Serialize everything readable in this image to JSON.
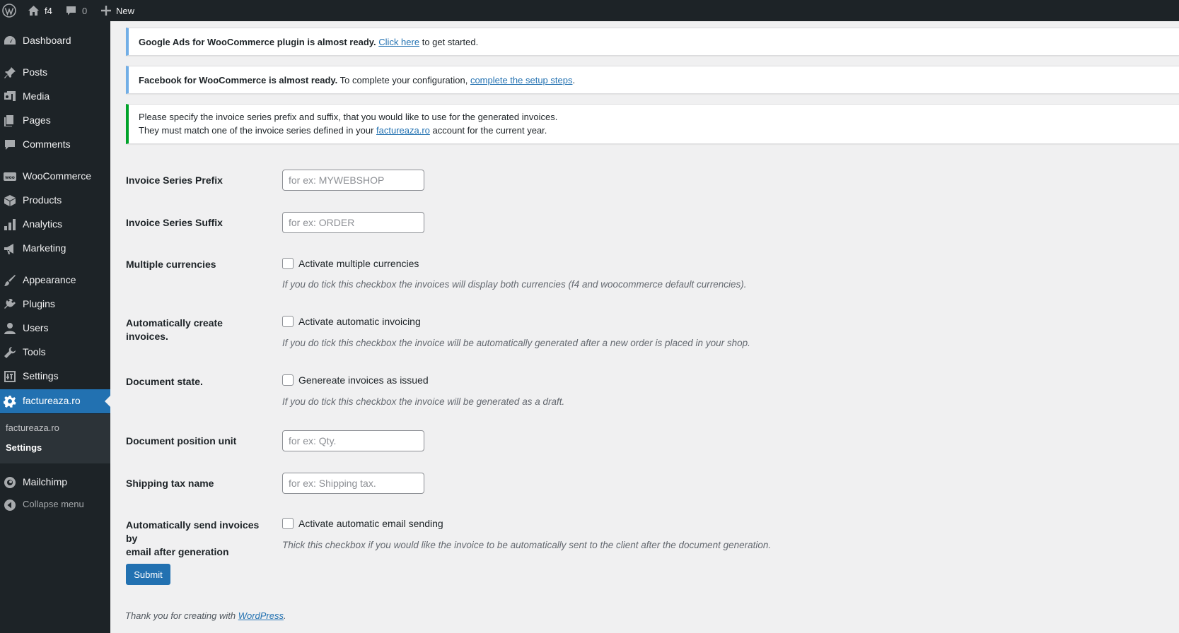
{
  "admin_bar": {
    "site_name": "f4",
    "comments_count": "0",
    "new_label": "New"
  },
  "sidebar": {
    "items": [
      {
        "label": "Dashboard",
        "icon": "dashboard-icon"
      },
      {
        "label": "Posts",
        "icon": "pin-icon"
      },
      {
        "label": "Media",
        "icon": "media-icon"
      },
      {
        "label": "Pages",
        "icon": "pages-icon"
      },
      {
        "label": "Comments",
        "icon": "comment-icon"
      },
      {
        "label": "WooCommerce",
        "icon": "woo-icon"
      },
      {
        "label": "Products",
        "icon": "box-icon"
      },
      {
        "label": "Analytics",
        "icon": "bar-chart-icon"
      },
      {
        "label": "Marketing",
        "icon": "megaphone-icon"
      },
      {
        "label": "Appearance",
        "icon": "brush-icon"
      },
      {
        "label": "Plugins",
        "icon": "plug-icon"
      },
      {
        "label": "Users",
        "icon": "user-icon"
      },
      {
        "label": "Tools",
        "icon": "wrench-icon"
      },
      {
        "label": "Settings",
        "icon": "sliders-icon"
      },
      {
        "label": "factureaza.ro",
        "icon": "gear-icon"
      },
      {
        "label": "Mailchimp",
        "icon": "mailchimp-icon"
      }
    ],
    "submenu": {
      "heading": "factureaza.ro",
      "current": "Settings"
    },
    "collapse_label": "Collapse menu"
  },
  "notices": {
    "google": {
      "bold": "Google Ads for WooCommerce plugin is almost ready.",
      "link": "Click here",
      "rest": "to get started."
    },
    "facebook": {
      "bold": "Facebook for WooCommerce is almost ready.",
      "text": "To complete your configuration,",
      "link": "complete the setup steps",
      "end": "."
    },
    "invoice": {
      "line1": "Please specify the invoice series prefix and suffix, that you would like to use for the generated invoices.",
      "line2_before": "They must match one of the invoice series defined in your",
      "line2_link": "factureaza.ro",
      "line2_after": "account for the current year."
    }
  },
  "form": {
    "prefix": {
      "label": "Invoice Series Prefix",
      "value": "",
      "placeholder": "for ex: MYWEBSHOP"
    },
    "suffix": {
      "label": "Invoice Series Suffix",
      "value": "",
      "placeholder": "for ex: ORDER"
    },
    "currencies": {
      "label": "Multiple currencies",
      "checkbox": "Activate multiple currencies",
      "checked": false,
      "description": "If you do tick this checkbox the invoices will display both currencies (f4 and woocommerce default currencies)."
    },
    "auto_create": {
      "label": "Automatically create invoices.",
      "checkbox": "Activate automatic invoicing",
      "checked": false,
      "description": "If you do tick this checkbox the invoice will be automatically generated after a new order is placed in your shop."
    },
    "doc_state": {
      "label": "Document state.",
      "checkbox": "Genereate invoices as issued",
      "checked": false,
      "description": "If you do tick this checkbox the invoice will be generated as a draft."
    },
    "position_unit": {
      "label": "Document position unit",
      "value": "",
      "placeholder": "for ex: Qty."
    },
    "shipping_tax": {
      "label": "Shipping tax name",
      "value": "",
      "placeholder": "for ex: Shipping tax."
    },
    "auto_email": {
      "label_line1": "Automatically send invoices by",
      "label_line2": "email after generation",
      "checkbox": "Activate automatic email sending",
      "checked": false,
      "description": "Thick this checkbox if you would like the invoice to be automatically sent to the client after the document generation."
    },
    "submit_label": "Submit"
  },
  "footer": {
    "text": "Thank you for creating with",
    "link": "WordPress",
    "end": "."
  },
  "colors": {
    "accent": "#2271b1",
    "admin_dark": "#1d2327",
    "notice_info": "#72aee6",
    "notice_success": "#00a32a"
  }
}
